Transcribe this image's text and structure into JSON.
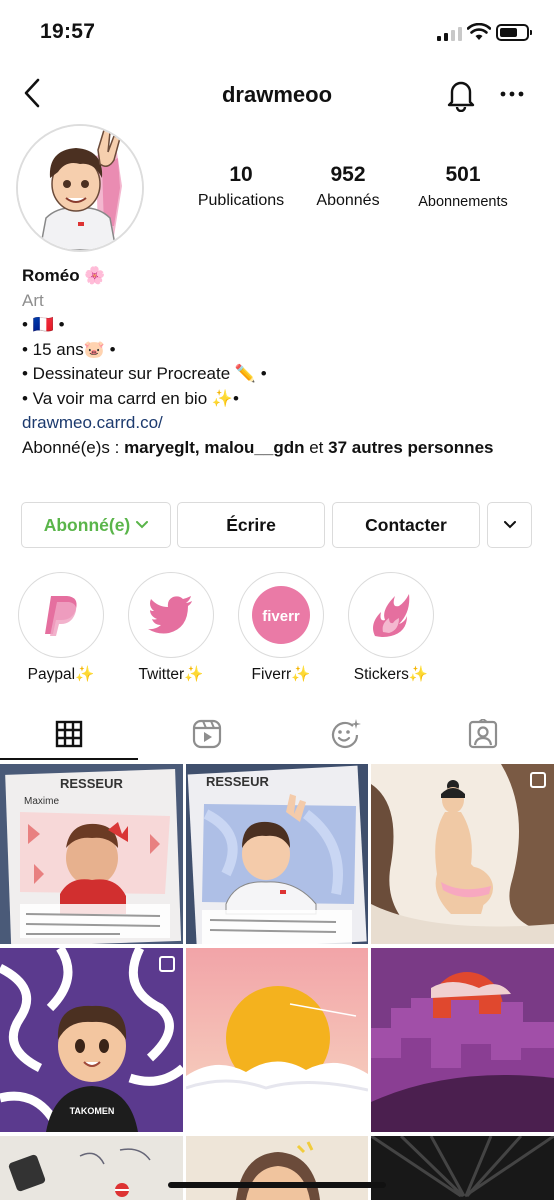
{
  "status_bar": {
    "time": "19:57"
  },
  "header": {
    "username": "drawmeoo"
  },
  "profile": {
    "stats": [
      {
        "value": "10",
        "label": "Publications"
      },
      {
        "value": "952",
        "label": "Abonnés"
      },
      {
        "value": "501",
        "label": "Abonnements"
      }
    ],
    "bio": {
      "name": "Roméo 🌸",
      "category": "Art",
      "lines": [
        "• 🇫🇷 •",
        "• 15 ans🐷 •",
        "• Dessinateur sur Procreate ✏️ •",
        "• Va voir ma carrd en bio ✨•"
      ],
      "link": "drawmeo.carrd.co/",
      "followed_by_prefix": "Abonné(e)s : ",
      "followed_by_users": "maryeglt, malou__gdn",
      "followed_by_and": " et ",
      "followed_by_rest": "37 autres personnes"
    }
  },
  "buttons": {
    "follow": "Abonné(e)",
    "message": "Écrire",
    "contact": "Contacter"
  },
  "highlights": [
    {
      "label": "Paypal",
      "icon": "paypal-icon"
    },
    {
      "label": "Twitter",
      "icon": "twitter-icon"
    },
    {
      "label": "Fiverr",
      "icon": "fiverr-icon"
    },
    {
      "label": "Stickers",
      "icon": "fire-icon"
    }
  ],
  "highlight_badges": {
    "fiverr": "fiverr"
  },
  "highlight_sparkle": "✨",
  "tabs": [
    "grid-icon",
    "reels-icon",
    "effects-icon",
    "tagged-icon"
  ],
  "posts": {
    "card_header": "RESSEUR",
    "card_name": "Maxime",
    "shirt_text": "TAKOMEN"
  },
  "colors": {
    "follow_green": "#5ab54a",
    "highlight_pink": "#e56f9f",
    "link_blue": "#1c3a6e"
  }
}
